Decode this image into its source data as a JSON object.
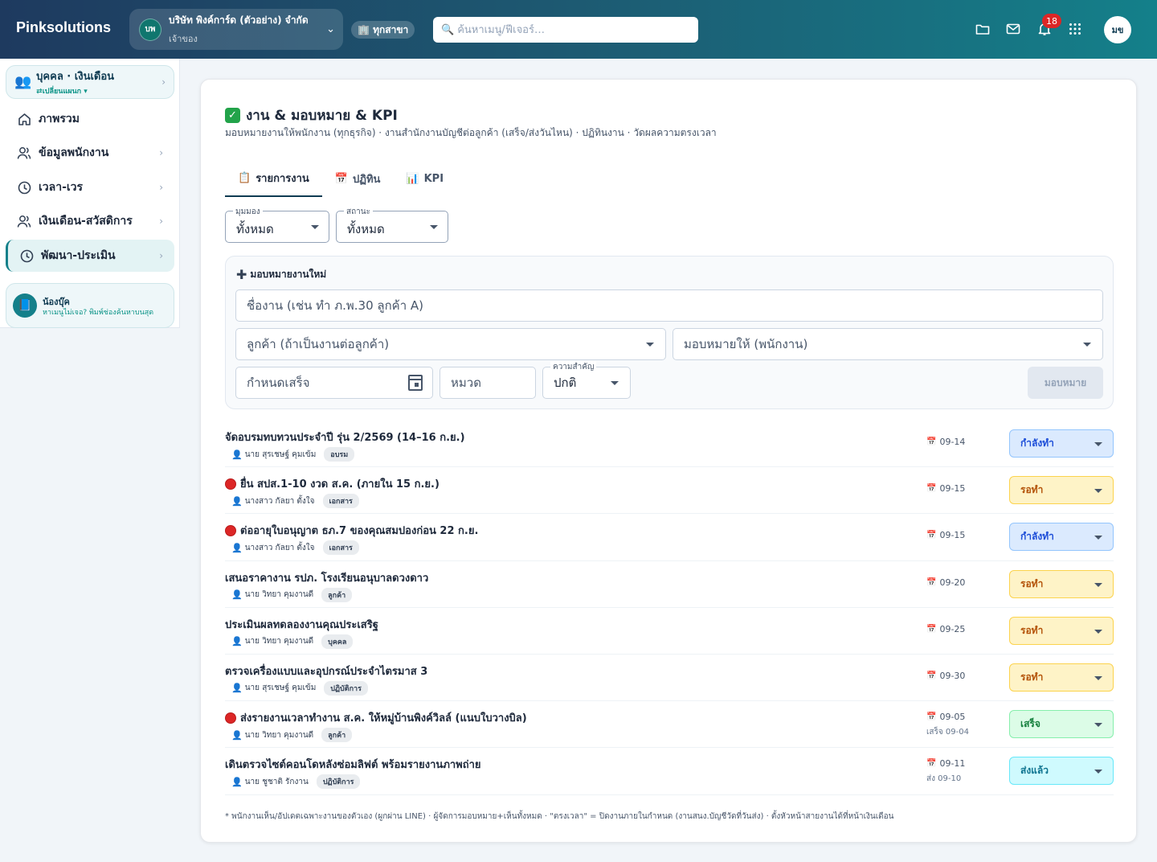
{
  "topbar": {
    "brand": "Pinksolutions",
    "company_initials": "บพ",
    "company_name": "บริษัท พิงค์การ์ด (ตัวอย่าง) จำกัด",
    "company_role": "เจ้าของ",
    "branch_label": "🏢 ทุกสาขา",
    "search_placeholder": "ค้นหาเมนู/ฟีเจอร์…",
    "notification_count": "18",
    "user_initials": "มข",
    "icons": [
      "folder-icon",
      "mail-icon",
      "bell-icon",
      "apps-grid-icon"
    ]
  },
  "sidebar": {
    "module_title": "บุคคล · เงินเดือน",
    "module_switch": "⇄เปลี่ยนแผนก ▾",
    "items": [
      {
        "label": "ภาพรวม",
        "icon": "home-icon",
        "has_chevron": false,
        "active": false
      },
      {
        "label": "ข้อมูลพนักงาน",
        "icon": "users-icon",
        "has_chevron": true,
        "active": false
      },
      {
        "label": "เวลา-เวร",
        "icon": "clock-icon",
        "has_chevron": true,
        "active": false
      },
      {
        "label": "เงินเดือน-สวัสดิการ",
        "icon": "users-icon",
        "has_chevron": true,
        "active": false
      },
      {
        "label": "พัฒนา-ประเมิน",
        "icon": "clock-icon",
        "has_chevron": true,
        "active": true
      }
    ],
    "helper_title": "น้องบุ๊ค",
    "helper_text": "หาเมนูไม่เจอ? พิมพ์ช่องค้นหาบนสุด"
  },
  "main": {
    "title": "งาน & มอบหมาย & KPI",
    "subtitle": "มอบหมายงานให้พนักงาน (ทุกธุรกิจ) · งานสำนักงานบัญชีต่อลูกค้า (เสร็จ/ส่งวันไหน) · ปฏิทินงาน · วัดผลความตรงเวลา",
    "tabs": [
      {
        "icon": "📋",
        "label": "รายการงาน",
        "active": true
      },
      {
        "icon": "📅",
        "label": "ปฏิทิน",
        "active": false
      },
      {
        "icon": "📊",
        "label": "KPI",
        "active": false
      }
    ],
    "filters": {
      "view_label": "มุมมอง",
      "view_value": "ทั้งหมด",
      "status_label": "สถานะ",
      "status_value": "ทั้งหมด"
    },
    "new_task": {
      "title": "มอบหมายงานใหม่",
      "name_placeholder": "ชื่องาน (เช่น ทำ ภ.พ.30 ลูกค้า A)",
      "customer_placeholder": "ลูกค้า (ถ้าเป็นงานต่อลูกค้า)",
      "assignee_placeholder": "มอบหมายให้ (พนักงาน)",
      "due_placeholder": "กำหนดเสร็จ",
      "category_placeholder": "หมวด",
      "priority_label": "ความสำคัญ",
      "priority_value": "ปกติ",
      "assign_button": "มอบหมาย"
    },
    "tasks": [
      {
        "title": "จัดอบรมทบทวนประจำปี รุ่น 2/2569 (14–16 ก.ย.)",
        "urgent": false,
        "person": "นาย สุรเชษฐ์ คุมเข้ม",
        "category": "อบรม",
        "due": "09-14",
        "done": "",
        "status": "กำลังทำ",
        "status_type": "progress"
      },
      {
        "title": "ยื่น สปส.1-10 งวด ส.ค. (ภายใน 15 ก.ย.)",
        "urgent": true,
        "person": "นางสาว กัลยา ตั้งใจ",
        "category": "เอกสาร",
        "due": "09-15",
        "done": "",
        "status": "รอทำ",
        "status_type": "todo"
      },
      {
        "title": "ต่ออายุใบอนุญาต ธภ.7 ของคุณสมปองก่อน 22 ก.ย.",
        "urgent": true,
        "person": "นางสาว กัลยา ตั้งใจ",
        "category": "เอกสาร",
        "due": "09-15",
        "done": "",
        "status": "กำลังทำ",
        "status_type": "progress"
      },
      {
        "title": "เสนอราคางาน รปภ. โรงเรียนอนุบาลดวงดาว",
        "urgent": false,
        "person": "นาย วิทยา คุมงานดี",
        "category": "ลูกค้า",
        "due": "09-20",
        "done": "",
        "status": "รอทำ",
        "status_type": "todo"
      },
      {
        "title": "ประเมินผลทดลองงานคุณประเสริฐ",
        "urgent": false,
        "person": "นาย วิทยา คุมงานดี",
        "category": "บุคคล",
        "due": "09-25",
        "done": "",
        "status": "รอทำ",
        "status_type": "todo"
      },
      {
        "title": "ตรวจเครื่องแบบและอุปกรณ์ประจำไตรมาส 3",
        "urgent": false,
        "person": "นาย สุรเชษฐ์ คุมเข้ม",
        "category": "ปฏิบัติการ",
        "due": "09-30",
        "done": "",
        "status": "รอทำ",
        "status_type": "todo"
      },
      {
        "title": "ส่งรายงานเวลาทำงาน ส.ค. ให้หมู่บ้านพิงค์วิลล์ (แนบใบวางบิล)",
        "urgent": true,
        "person": "นาย วิทยา คุมงานดี",
        "category": "ลูกค้า",
        "due": "09-05",
        "done": "เสร็จ 09-04",
        "status": "เสร็จ",
        "status_type": "done"
      },
      {
        "title": "เดินตรวจไซต์คอนโดหลังซ่อมลิฟต์ พร้อมรายงานภาพถ่าย",
        "urgent": false,
        "person": "นาย ชูชาติ รักงาน",
        "category": "ปฏิบัติการ",
        "due": "09-11",
        "done": "ส่ง 09-10",
        "status": "ส่งแล้ว",
        "status_type": "sent"
      }
    ],
    "status_colors": {
      "progress": {
        "bg": "#dbeafe",
        "border": "#93c5fd",
        "text": "#1d4ed8"
      },
      "todo": {
        "bg": "#fef3c7",
        "border": "#fcd34d",
        "text": "#b45309"
      },
      "done": {
        "bg": "#dcfce7",
        "border": "#86efac",
        "text": "#15803d"
      },
      "sent": {
        "bg": "#cffafe",
        "border": "#67e8f9",
        "text": "#0e7490"
      }
    },
    "footnote": "* พนักงานเห็น/อัปเดตเฉพาะงานของตัวเอง (ผูกผ่าน LINE) · ผู้จัดการมอบหมาย+เห็นทั้งหมด · \"ตรงเวลา\" = ปิดงานภายในกำหนด (งานสนง.บัญชีวัดที่วันส่ง) · ตั้งหัวหน้าสายงานได้ที่หน้าเงินเดือน"
  }
}
